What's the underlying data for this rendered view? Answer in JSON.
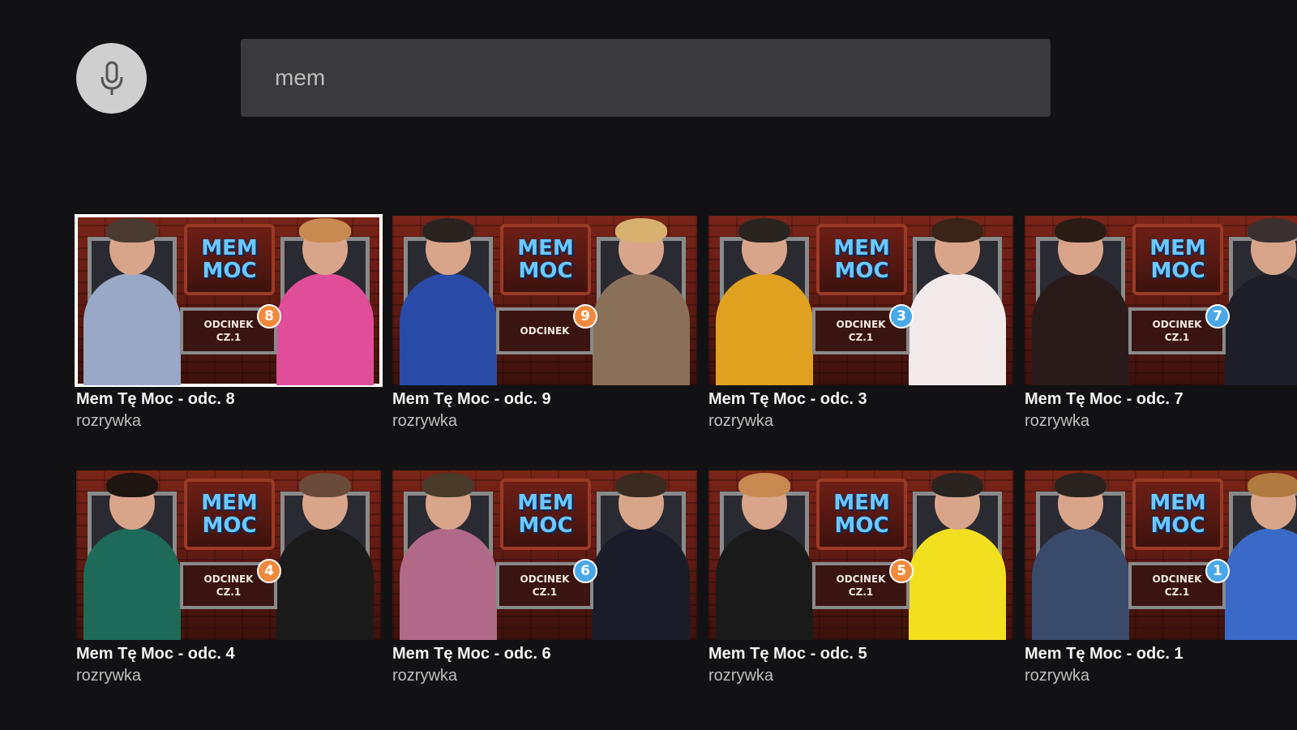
{
  "search": {
    "value": "mem",
    "placeholder": ""
  },
  "badge_colors": {
    "orange": "#f08a3c",
    "blue": "#4aa8e8"
  },
  "cards": [
    {
      "title": "Mem Tę Moc - odc. 8",
      "genre": "rozrywka",
      "episode": "8",
      "badge": "orange",
      "plate_line1": "ODCINEK",
      "plate_line2": "CZ.1",
      "left_shirt": "#9aa8c8",
      "right_shirt": "#e04e9a",
      "left_hair": "#4a3a30",
      "right_hair": "#c98a52"
    },
    {
      "title": "Mem Tę Moc - odc. 9",
      "genre": "rozrywka",
      "episode": "9",
      "badge": "orange",
      "plate_line1": "ODCINEK",
      "plate_line2": "",
      "left_shirt": "#2a4aa8",
      "right_shirt": "#8a7058",
      "left_hair": "#2a2420",
      "right_hair": "#d8b070"
    },
    {
      "title": "Mem Tę Moc - odc. 3",
      "genre": "rozrywka",
      "episode": "3",
      "badge": "blue",
      "plate_line1": "ODCINEK",
      "plate_line2": "CZ.1",
      "left_shirt": "#e0a020",
      "right_shirt": "#f2eaea",
      "left_hair": "#2a2420",
      "right_hair": "#3a2418"
    },
    {
      "title": "Mem Tę Moc - odc. 7",
      "genre": "rozrywka",
      "episode": "7",
      "badge": "blue",
      "plate_line1": "ODCINEK",
      "plate_line2": "CZ.1",
      "left_shirt": "#2a1a1a",
      "right_shirt": "#1e1e28",
      "left_hair": "#2a1c14",
      "right_hair": "#3a3030"
    },
    {
      "title": "Mem Tę Moc - odc. 4",
      "genre": "rozrywka",
      "episode": "4",
      "badge": "orange",
      "plate_line1": "ODCINEK",
      "plate_line2": "CZ.1",
      "left_shirt": "#1e6a58",
      "right_shirt": "#1a1a1a",
      "left_hair": "#1e1410",
      "right_hair": "#6a4a38"
    },
    {
      "title": "Mem Tę Moc - odc. 6",
      "genre": "rozrywka",
      "episode": "6",
      "badge": "blue",
      "plate_line1": "ODCINEK",
      "plate_line2": "CZ.1",
      "left_shirt": "#b06a88",
      "right_shirt": "#1a1c2a",
      "left_hair": "#4a3a2a",
      "right_hair": "#3a2a20"
    },
    {
      "title": "Mem Tę Moc - odc. 5",
      "genre": "rozrywka",
      "episode": "5",
      "badge": "orange",
      "plate_line1": "ODCINEK",
      "plate_line2": "CZ.1",
      "left_shirt": "#1a1a1a",
      "right_shirt": "#f2e020",
      "left_hair": "#c88a50",
      "right_hair": "#2a2420"
    },
    {
      "title": "Mem Tę Moc - odc. 1",
      "genre": "rozrywka",
      "episode": "1",
      "badge": "blue",
      "plate_line1": "ODCINEK",
      "plate_line2": "CZ.1",
      "left_shirt": "#3a4a6a",
      "right_shirt": "#3a6ac8",
      "left_hair": "#2a2420",
      "right_hair": "#b07a40"
    }
  ],
  "logo": {
    "line1": "MEM",
    "line2": "MOC"
  },
  "focused_index": 0
}
